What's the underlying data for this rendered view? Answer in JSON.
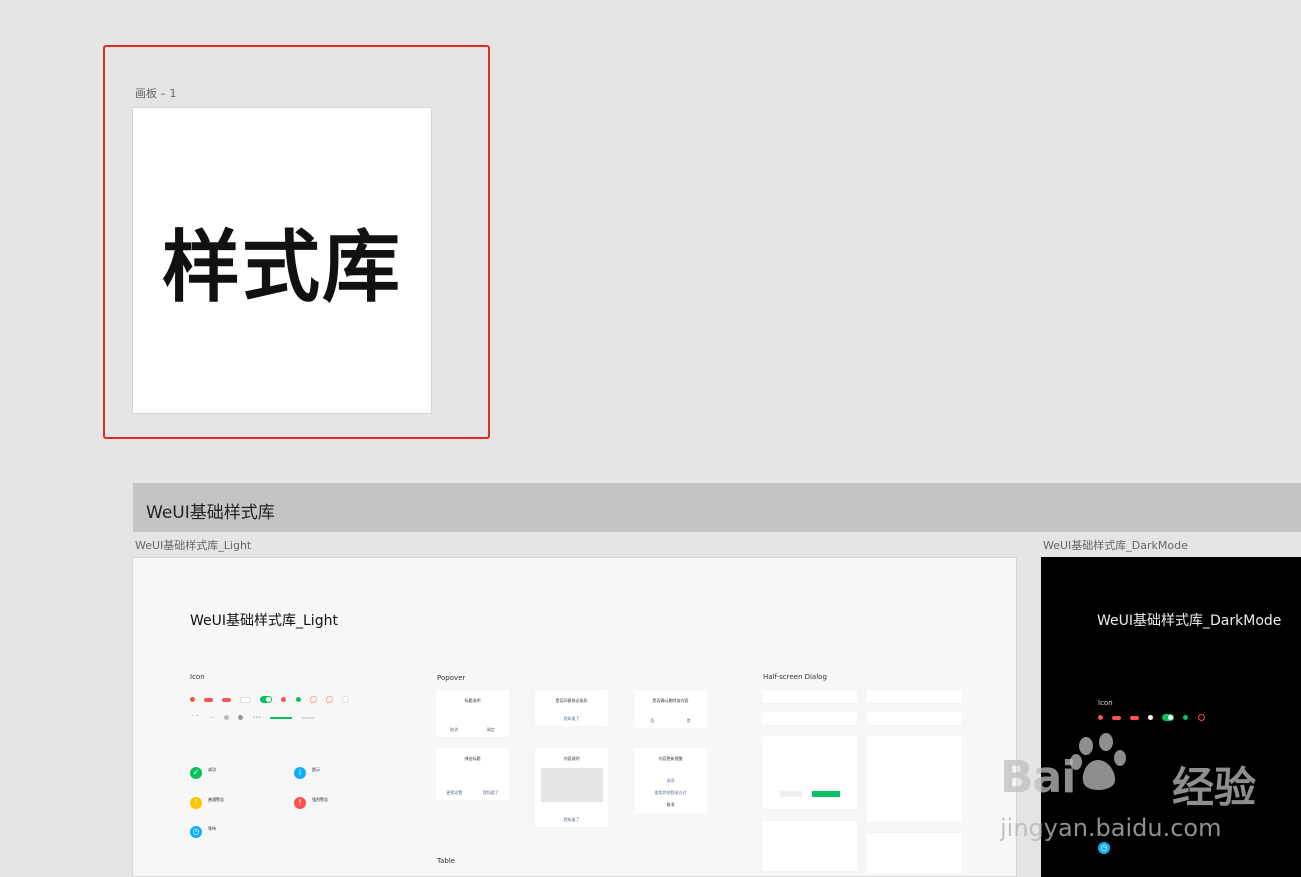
{
  "artboard1": {
    "label": "画板 – 1",
    "content": "样式库"
  },
  "group": {
    "title": "WeUI基础样式库"
  },
  "light": {
    "label": "WeUI基础样式库_Light",
    "title": "WeUI基础样式库_Light",
    "sections": {
      "icon": "Icon",
      "popover": "Popover",
      "half_screen": "Half-screen Dialog",
      "table": "Table"
    },
    "statuses": [
      {
        "title": "成功",
        "color": "#07c160",
        "glyph": "✓"
      },
      {
        "title": "提示",
        "color": "#10aeff",
        "glyph": "i"
      },
      {
        "title": "普通警告",
        "color": "#ffc300",
        "glyph": "!"
      },
      {
        "title": "强烈警告",
        "color": "#fa5151",
        "glyph": "!"
      },
      {
        "title": "等待",
        "color": "#10aeff",
        "glyph": "◷"
      }
    ],
    "popover_cards": [
      {
        "title": "标题说明",
        "btn_left": "取消",
        "btn_right": "确定"
      },
      {
        "title": "是否同意协议条款",
        "action": "我知道了"
      },
      {
        "title": "是否确认删除该内容",
        "btn_left": "否",
        "btn_right": "是"
      },
      {
        "title": "弹出标题",
        "btn_left": "更换设置",
        "btn_right": "我知道了"
      },
      {
        "title": "内容说明",
        "action": "我知道了"
      },
      {
        "title": "内容更新提醒",
        "opt1": "选项",
        "opt2": "使用其他登录方式",
        "opt3": "取消"
      }
    ]
  },
  "dark": {
    "label": "WeUI基础样式库_DarkMode",
    "title": "WeUI基础样式库_DarkMode",
    "sections": {
      "icon": "Icon"
    }
  },
  "watermark": {
    "brand": "Bai",
    "brand_cn": "经验",
    "url": "jingyan.baidu.com"
  },
  "colors": {
    "accent_red": "#e12a20",
    "wechat_green": "#07c160",
    "link_blue": "#576b95"
  }
}
